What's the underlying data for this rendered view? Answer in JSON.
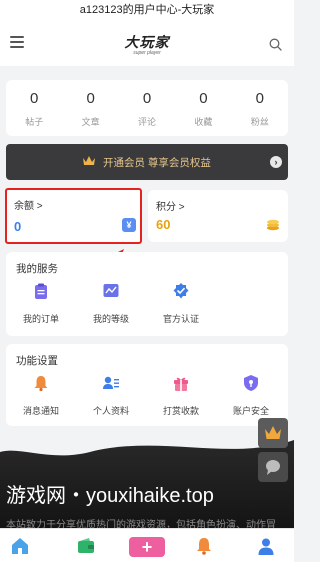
{
  "window": {
    "title": "a123123的用户中心-大玩家"
  },
  "header": {
    "logo_text_main": "大玩家",
    "logo_text_sub": "super player"
  },
  "stats": [
    {
      "value": "0",
      "label": "帖子"
    },
    {
      "value": "0",
      "label": "文章"
    },
    {
      "value": "0",
      "label": "评论"
    },
    {
      "value": "0",
      "label": "收藏"
    },
    {
      "value": "0",
      "label": "粉丝"
    }
  ],
  "vip": {
    "label": "开通会员 尊享会员权益",
    "arrow": "›"
  },
  "balance": {
    "label": "余额 >",
    "value": "0",
    "icon": "¥"
  },
  "points": {
    "label": "积分 >",
    "value": "60"
  },
  "services": {
    "title": "我的服务",
    "items": [
      {
        "label": "我的订单",
        "icon": "clipboard-icon"
      },
      {
        "label": "我的等级",
        "icon": "chart-icon"
      },
      {
        "label": "官方认证",
        "icon": "verified-badge-icon"
      }
    ]
  },
  "settings": {
    "title": "功能设置",
    "items": [
      {
        "label": "消息通知",
        "icon": "bell-icon"
      },
      {
        "label": "个人资料",
        "icon": "profile-icon"
      },
      {
        "label": "打赏收款",
        "icon": "gift-icon"
      },
      {
        "label": "账户安全",
        "icon": "shield-icon"
      }
    ]
  },
  "banner": {
    "watermark": "游戏网・youxihaike.top",
    "desc": "本站致力于分享优质热门的游戏资源，包括角色扮演、动作冒"
  },
  "tabbar": {
    "items": [
      "home-icon",
      "wallet-icon",
      "add-icon",
      "bell-icon",
      "user-icon"
    ],
    "add_label": "+"
  },
  "colors": {
    "accent_blue": "#3d7ee8",
    "gold": "#e6a312",
    "pink": "#ee5fa0",
    "highlight_red": "#e5221d",
    "vip_bg": "#3a3a3d"
  }
}
